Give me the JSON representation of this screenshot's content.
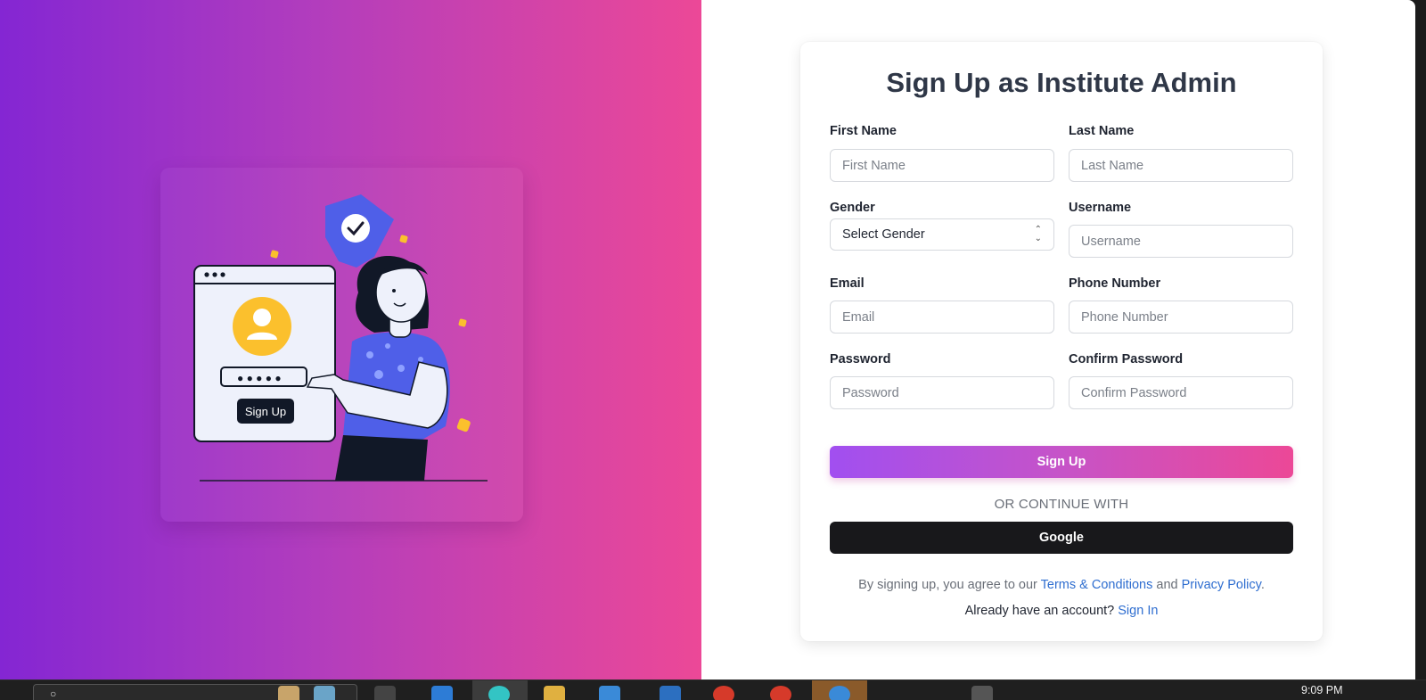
{
  "illustration": {
    "button_label": "Sign Up",
    "password_dots": "● ● ● ● ●"
  },
  "form": {
    "title": "Sign Up as Institute Admin",
    "first_name": {
      "label": "First Name",
      "placeholder": "First Name"
    },
    "last_name": {
      "label": "Last Name",
      "placeholder": "Last Name"
    },
    "gender": {
      "label": "Gender",
      "selected": "Select Gender"
    },
    "username": {
      "label": "Username",
      "placeholder": "Username"
    },
    "email": {
      "label": "Email",
      "placeholder": "Email"
    },
    "phone": {
      "label": "Phone Number",
      "placeholder": "Phone Number"
    },
    "password": {
      "label": "Password",
      "placeholder": "Password"
    },
    "confirm_password": {
      "label": "Confirm Password",
      "placeholder": "Confirm Password"
    },
    "signup_button": "Sign Up",
    "divider_text": "OR CONTINUE WITH",
    "google_button": "Google",
    "terms_prefix": "By signing up, you agree to our",
    "terms_link": "Terms & Conditions",
    "terms_and": "and",
    "privacy_link": "Privacy Policy",
    "terms_suffix": ".",
    "already_text": "Already have an account?",
    "signin_link": "Sign In"
  },
  "taskbar": {
    "clock": "9:09 PM"
  },
  "colors": {
    "gradient_start": "#8426d3",
    "gradient_end": "#ec4897",
    "link": "#2f6ed0",
    "title": "#2f3747",
    "illustration_accent": "#4f5fe8",
    "illustration_yellow": "#fbc02d"
  }
}
